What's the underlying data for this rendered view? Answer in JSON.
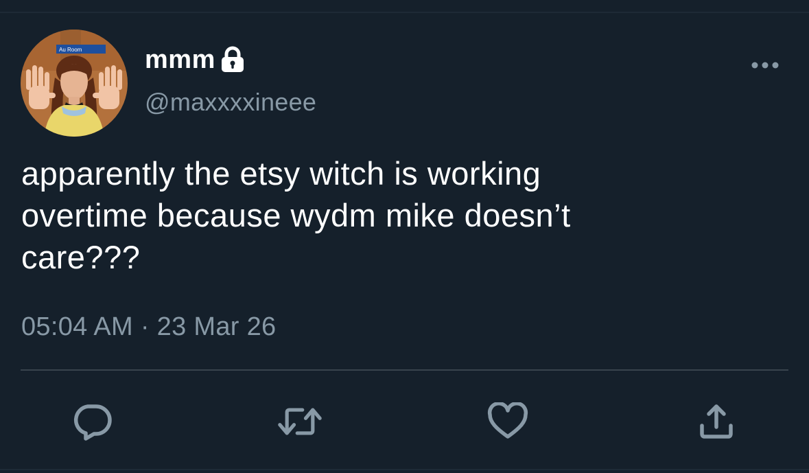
{
  "user": {
    "display_name": "mmm",
    "handle": "@maxxxxineee",
    "avatar_sign_text": "Au     Room",
    "protected_icon": "lock-icon"
  },
  "tweet": {
    "text": "apparently the etsy witch is working\novertime because wydm mike doesn’t\ncare???",
    "time": "05:04 AM",
    "separator": "·",
    "date": "23 Mar 26"
  },
  "menu": {
    "icon": "more-horizontal-icon"
  },
  "actions": [
    {
      "name": "reply",
      "icon": "reply-icon"
    },
    {
      "name": "retweet",
      "icon": "retweet-icon"
    },
    {
      "name": "like",
      "icon": "heart-icon"
    },
    {
      "name": "share",
      "icon": "share-icon"
    }
  ],
  "colors": {
    "background": "#15202b",
    "text_primary": "#ffffff",
    "text_secondary": "#8899a6",
    "icon": "#8899a6",
    "divider": "#38444d"
  }
}
